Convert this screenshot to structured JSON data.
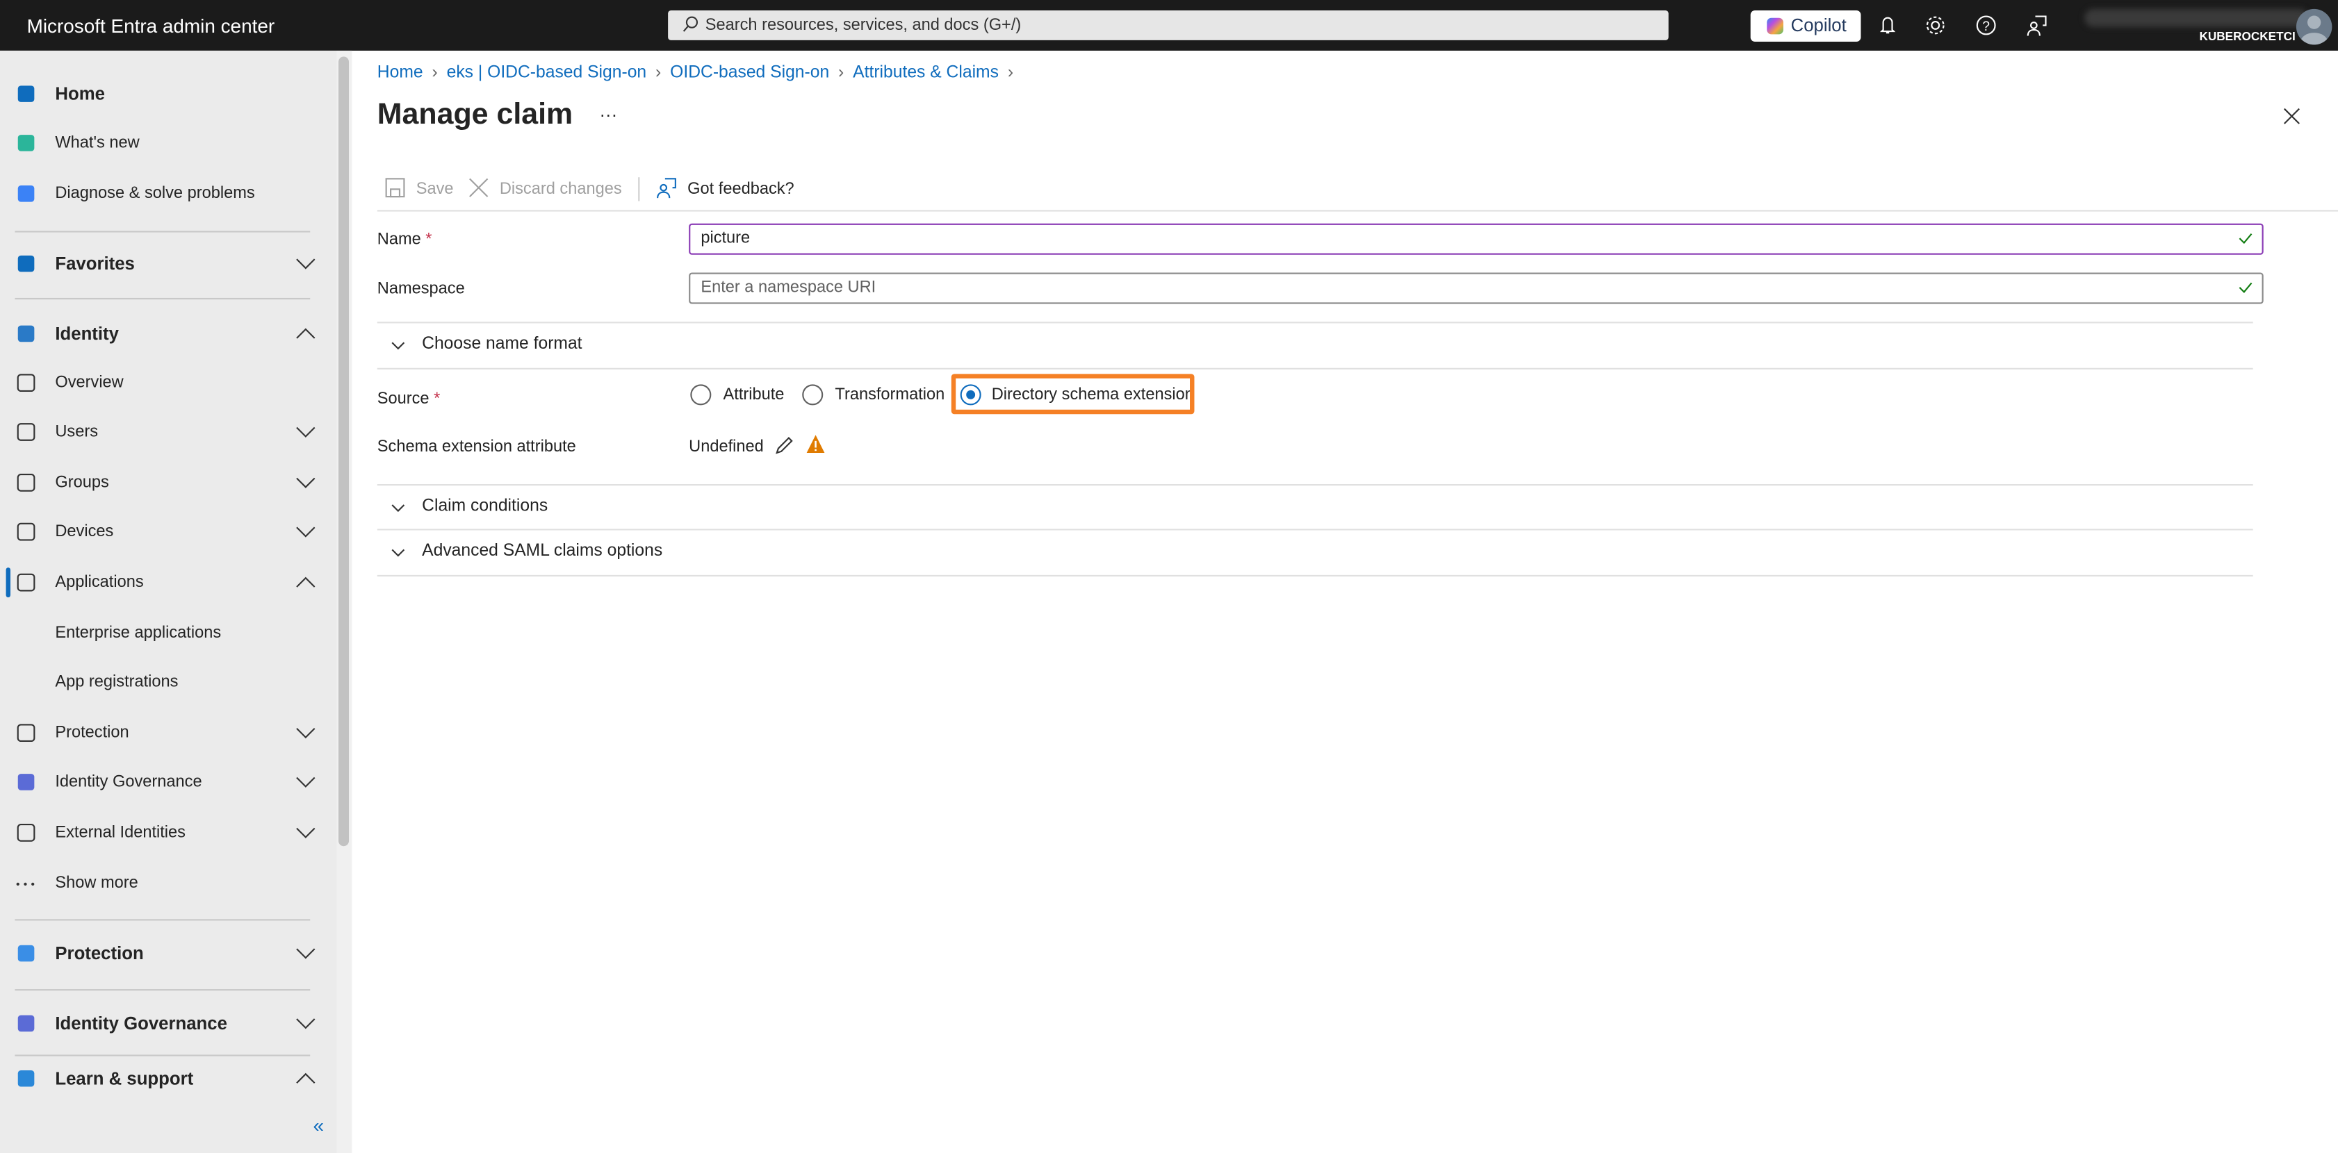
{
  "topbar": {
    "brand": "Microsoft Entra admin center",
    "search_placeholder": "Search resources, services, and docs (G+/)",
    "copilot_label": "Copilot",
    "icons": [
      "bell-icon",
      "gear-icon",
      "help-icon",
      "feedback-icon"
    ],
    "account_tenant": "KUBEROCKETCI"
  },
  "sidebar": {
    "items": [
      {
        "label": "Home",
        "icon": "home-icon"
      },
      {
        "label": "What's new",
        "icon": "flag-icon"
      },
      {
        "label": "Diagnose & solve problems",
        "icon": "diagnose-icon"
      },
      {
        "label": "Favorites",
        "icon": "star-icon",
        "expanded": false
      },
      {
        "label": "Identity",
        "icon": "identity-icon",
        "expanded": true
      },
      {
        "label": "Overview",
        "icon": "info-icon"
      },
      {
        "label": "Users",
        "icon": "user-icon",
        "expanded": false
      },
      {
        "label": "Groups",
        "icon": "groups-icon",
        "expanded": false
      },
      {
        "label": "Devices",
        "icon": "devices-icon",
        "expanded": false
      },
      {
        "label": "Applications",
        "icon": "applications-icon",
        "expanded": true,
        "active": true
      },
      {
        "label": "Enterprise applications"
      },
      {
        "label": "App registrations"
      },
      {
        "label": "Protection",
        "icon": "lock-icon",
        "expanded": false
      },
      {
        "label": "Identity Governance",
        "icon": "governance-icon",
        "expanded": false
      },
      {
        "label": "External Identities",
        "icon": "external-icon",
        "expanded": false
      },
      {
        "label": "Show more",
        "icon": "more-icon"
      },
      {
        "label": "Protection",
        "icon": "protection-icon",
        "expanded": false
      },
      {
        "label": "Identity Governance",
        "icon": "governance-icon",
        "expanded": false
      },
      {
        "label": "Learn & support",
        "icon": "learn-icon",
        "expanded": true
      }
    ],
    "collapse_label": "«"
  },
  "breadcrumb": [
    "Home",
    "eks | OIDC-based Sign-on",
    "OIDC-based Sign-on",
    "Attributes & Claims"
  ],
  "page": {
    "title": "Manage claim",
    "more": "···"
  },
  "toolbar": {
    "save": "Save",
    "discard": "Discard changes",
    "feedback": "Got feedback?"
  },
  "form": {
    "name_label": "Name",
    "required_mark": "*",
    "name_value": "picture",
    "namespace_label": "Namespace",
    "namespace_placeholder": "Enter a namespace URI",
    "choose_name_format": "Choose name format",
    "source_label": "Source",
    "source_options": [
      "Attribute",
      "Transformation",
      "Directory schema extension"
    ],
    "source_selected": "Directory schema extension",
    "schema_ext_label": "Schema extension attribute",
    "schema_ext_value": "Undefined",
    "claim_conditions": "Claim conditions",
    "advanced_saml": "Advanced SAML claims options"
  },
  "colors": {
    "accent": "#0f6cbd",
    "highlight": "#f58025",
    "warning": "#e07b00",
    "focus_border": "#8a3bb5"
  }
}
